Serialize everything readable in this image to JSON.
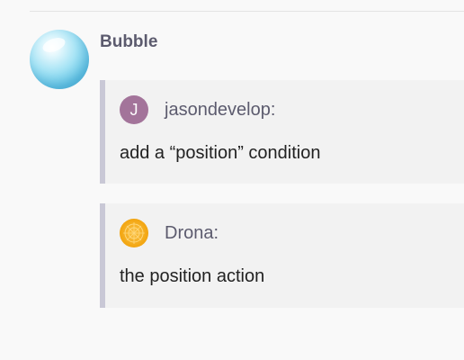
{
  "post": {
    "author": "Bubble",
    "avatar_icon": "bubble-avatar"
  },
  "quotes": [
    {
      "user": "jasondevelop:",
      "avatar_letter": "J",
      "avatar_color": "#a3749a",
      "text": "add a “position” condition"
    },
    {
      "user": "Drona:",
      "avatar_icon": "sun-avatar",
      "avatar_color": "#f3a713",
      "text": "the position action"
    }
  ]
}
